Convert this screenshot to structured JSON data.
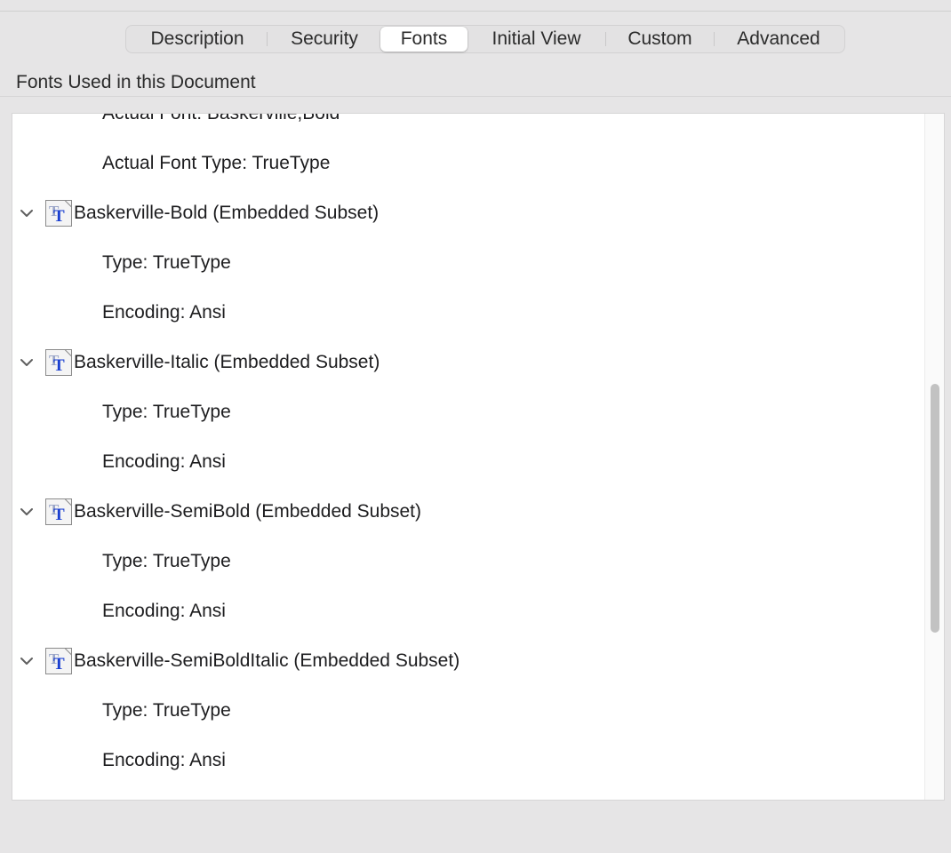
{
  "tabs": [
    {
      "label": "Description",
      "selected": false
    },
    {
      "label": "Security",
      "selected": false
    },
    {
      "label": "Fonts",
      "selected": true
    },
    {
      "label": "Initial View",
      "selected": false
    },
    {
      "label": "Custom",
      "selected": false
    },
    {
      "label": "Advanced",
      "selected": false
    }
  ],
  "section_title": "Fonts Used in this Document",
  "tree": {
    "partial_rows": [
      "Actual Font: Baskerville,Bold",
      "Actual Font Type: TrueType"
    ],
    "fonts": [
      {
        "name": "Baskerville-Bold (Embedded Subset)",
        "expanded": true,
        "icon": "truetype-font-icon",
        "details": [
          "Type: TrueType",
          "Encoding: Ansi"
        ]
      },
      {
        "name": "Baskerville-Italic (Embedded Subset)",
        "expanded": true,
        "icon": "truetype-font-icon",
        "details": [
          "Type: TrueType",
          "Encoding: Ansi"
        ]
      },
      {
        "name": "Baskerville-SemiBold (Embedded Subset)",
        "expanded": true,
        "icon": "truetype-font-icon",
        "details": [
          "Type: TrueType",
          "Encoding: Ansi"
        ]
      },
      {
        "name": "Baskerville-SemiBoldItalic (Embedded Subset)",
        "expanded": true,
        "icon": "truetype-font-icon",
        "details": [
          "Type: TrueType",
          "Encoding: Ansi"
        ]
      }
    ]
  },
  "colors": {
    "window_bg": "#e6e5e6",
    "panel_bg": "#ffffff",
    "font_icon_blue": "#1a3fd1",
    "scroll_thumb": "#c2c2c2"
  }
}
